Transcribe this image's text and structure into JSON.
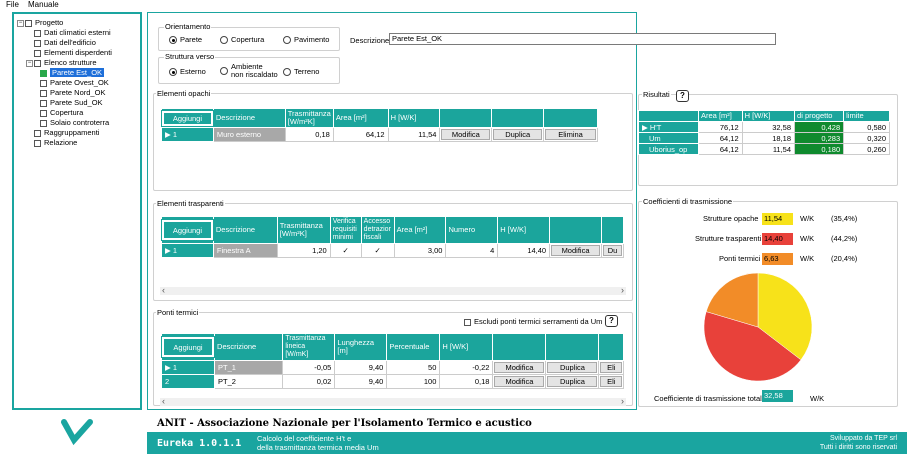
{
  "menu": {
    "file": "File",
    "manuale": "Manuale"
  },
  "tree": {
    "root": "Progetto",
    "items": [
      {
        "label": "Dati climatici esterni",
        "checked": false
      },
      {
        "label": "Dati dell'edificio",
        "checked": false
      },
      {
        "label": "Elementi disperdenti",
        "checked": false
      },
      {
        "label": "Elenco strutture",
        "checked": false
      }
    ],
    "strutture": [
      {
        "label": "Parete Est_OK",
        "checked": true,
        "selected": true
      },
      {
        "label": "Parete Ovest_OK",
        "checked": false
      },
      {
        "label": "Parete Nord_OK",
        "checked": false
      },
      {
        "label": "Parete Sud_OK",
        "checked": false
      },
      {
        "label": "Copertura",
        "checked": false
      },
      {
        "label": "Solaio controterra",
        "checked": false
      }
    ],
    "tail": [
      {
        "label": "Raggruppamenti",
        "checked": false
      },
      {
        "label": "Relazione",
        "checked": false
      }
    ]
  },
  "orientamento": {
    "title": "Orientamento",
    "options": [
      "Parete",
      "Copertura",
      "Pavimento"
    ],
    "selected": "Parete"
  },
  "struttura_verso": {
    "title": "Struttura verso",
    "options": [
      "Esterno",
      "Ambiente non riscaldato",
      "Terreno"
    ],
    "opt2_line1": "Ambiente",
    "opt2_line2": "non riscaldato",
    "selected": "Esterno"
  },
  "descrizione": {
    "label": "Descrizione",
    "value": "Parete Est_OK"
  },
  "opachi": {
    "title": "Elementi opachi",
    "add": "Aggiungi",
    "headers": [
      "Descrizione",
      "Trasmittanza [W/m²K]",
      "Area [m²]",
      "H [W/K]"
    ],
    "h_tras1": "Trasmittanza",
    "h_tras2": "[W/m²K]",
    "rows": [
      {
        "n": "1",
        "desc": "Muro esterno",
        "tras": "0,18",
        "area": "64,12",
        "h": "11,54",
        "b1": "Modifica",
        "b2": "Duplica",
        "b3": "Elimina"
      }
    ]
  },
  "trasparenti": {
    "title": "Elementi trasparenti",
    "add": "Aggiungi",
    "h_desc": "Descrizione",
    "h_tras1": "Trasmittanza",
    "h_tras2": "[W/m²K]",
    "h_ver1": "Verifica",
    "h_ver2": "requisiti",
    "h_ver3": "minimi",
    "h_acc1": "Accesso",
    "h_acc2": "detrazior",
    "h_acc3": "fiscali",
    "h_area": "Area [m²]",
    "h_num": "Numero",
    "h_h": "H [W/K]",
    "rows": [
      {
        "n": "1",
        "desc": "Finestra A",
        "tras": "1,20",
        "area": "3,00",
        "num": "4",
        "h": "14,40",
        "b1": "Modifica",
        "b2": "Du"
      }
    ]
  },
  "ponti": {
    "title": "Ponti termici",
    "escludi": "Escludi ponti termici serramenti da Um",
    "add": "Aggiungi",
    "h_desc": "Descrizione",
    "h_tras1": "Trasmittanza",
    "h_tras2": "lineica",
    "h_tras3": "[W/mK]",
    "h_lun1": "Lunghezza",
    "h_lun2": "[m]",
    "h_perc": "Percentuale",
    "h_h": "H [W/K]",
    "rows": [
      {
        "n": "1",
        "desc": "PT_1",
        "tras": "-0,05",
        "lun": "9,40",
        "perc": "50",
        "h": "-0,22",
        "b1": "Modifica",
        "b2": "Duplica",
        "b3": "Eli"
      },
      {
        "n": "2",
        "desc": "PT_2",
        "tras": "0,02",
        "lun": "9,40",
        "perc": "100",
        "h": "0,18",
        "b1": "Modifica",
        "b2": "Duplica",
        "b3": "Eli"
      }
    ]
  },
  "risultati": {
    "title": "Risultati",
    "headers": [
      "Area [m²]",
      "H [W/K]",
      "di progetto",
      "limite"
    ],
    "rows": [
      {
        "name": "H'T",
        "area": "76,12",
        "h": "32,58",
        "prog": "0,428",
        "lim": "0,580"
      },
      {
        "name": "Um",
        "area": "64,12",
        "h": "18,18",
        "prog": "0,283",
        "lim": "0,320"
      },
      {
        "name": "Uborius_op",
        "area": "64,12",
        "h": "11,54",
        "prog": "0,180",
        "lim": "0,260"
      }
    ]
  },
  "coefficienti": {
    "title": "Coefficienti di trasmissione",
    "items": [
      {
        "label": "Strutture opache",
        "value": "11,54",
        "unit": "W/K",
        "pct": "(35,4%)",
        "color": "#f7e21a",
        "share": 35.4
      },
      {
        "label": "Strutture trasparenti",
        "value": "14,40",
        "unit": "W/K",
        "pct": "(44,2%)",
        "color": "#e8413a",
        "share": 44.2
      },
      {
        "label": "Ponti termici",
        "value": "6,63",
        "unit": "W/K",
        "pct": "(20,4%)",
        "color": "#f28c28",
        "share": 20.4
      }
    ],
    "totale_label": "Coefficiente di trasmissione totale",
    "totale_value": "32,58",
    "totale_unit": "W/K"
  },
  "footer": {
    "org": "ANIT - Associazione Nazionale per l'Isolamento Termico e acustico",
    "app": "Eureka 1.0.1.1",
    "desc1": "Calcolo del coefficiente H't e",
    "desc2": "della trasmittanza termica media Um",
    "dev1": "Sviluppato da TEP srl",
    "dev2": "Tutti i diritti sono riservati"
  },
  "colors": {
    "accent": "#1ba59c",
    "green": "#0f8a2e",
    "selection": "#1e6fd9"
  }
}
